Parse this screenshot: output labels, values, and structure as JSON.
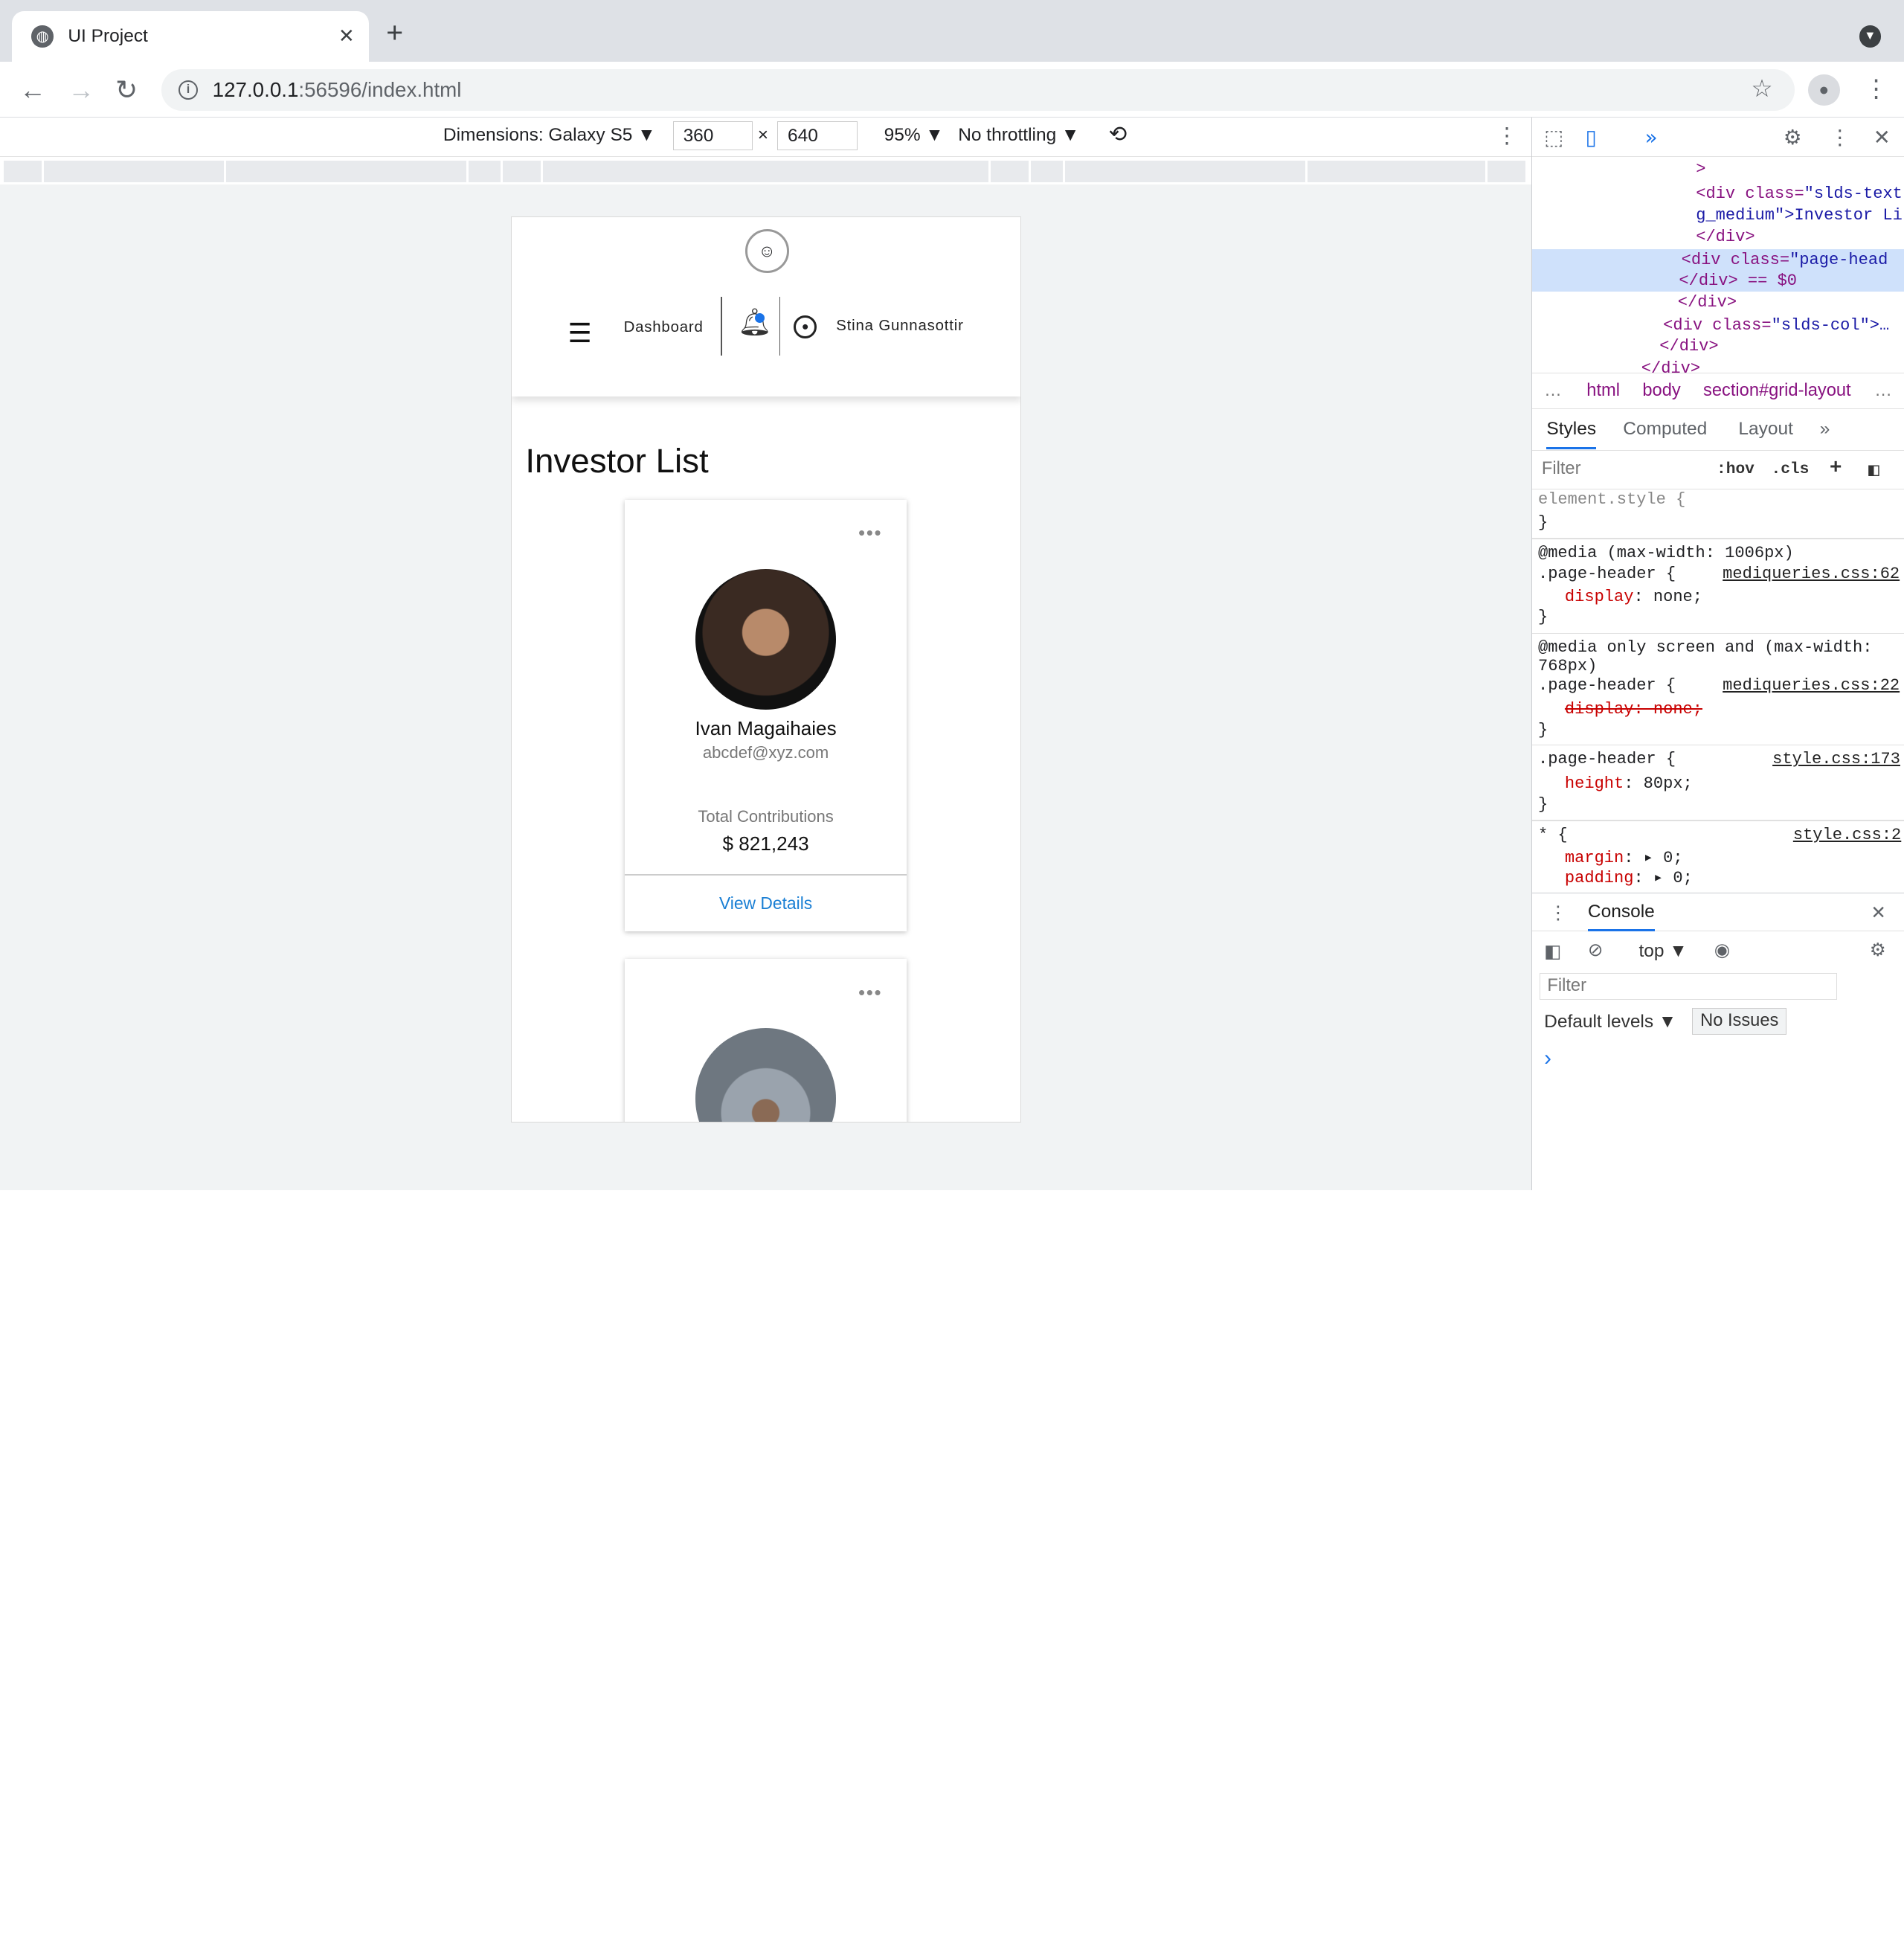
{
  "browser": {
    "tab_title": "UI Project",
    "url_host": "127.0.0.1",
    "url_rest": ":56596/index.html"
  },
  "device_toolbar": {
    "dimensions_label": "Dimensions: Galaxy S5 ▼",
    "width": "360",
    "height": "640",
    "times": "×",
    "zoom": "95% ▼",
    "throttling": "No throttling ▼"
  },
  "app": {
    "nav": {
      "dashboard_label": "Dashboard",
      "user_name": "Stina Gunnasottir"
    },
    "page_title": "Investor List",
    "investors": [
      {
        "name": "Ivan Magaihaies",
        "email": "abcdef@xyz.com",
        "contrib_label": "Total Contributions",
        "contrib_value": "$ 821,243",
        "link_label": "View Details"
      }
    ]
  },
  "devtools": {
    "dom_lines": {
      "l1": ">",
      "l2_tag": "<div class=",
      "l2_val": "\"slds-text",
      "l3": "g_medium\">Investor Li",
      "l4": "</div>",
      "l5_tag": "<div class=",
      "l5_val": "\"page-head",
      "l6": "</div> == $0",
      "l7": "</div>",
      "l8_tag": "<div class=",
      "l8_val": "\"slds-col\">…",
      "l9": "</div>",
      "l10": "</div>"
    },
    "breadcrumbs": {
      "dots": "…",
      "html": "html",
      "body": "body",
      "section": "section#grid-layout",
      "more": "…"
    },
    "tabs": {
      "styles": "Styles",
      "computed": "Computed",
      "layout": "Layout",
      "more": "»"
    },
    "filter_placeholder": "Filter",
    "hov": ":hov",
    "cls": ".cls",
    "rules": {
      "r1": "element.style {",
      "r1c": "}",
      "r2a": "@media (max-width: 1006px)",
      "r2b": ".page-header {",
      "r2src": "mediqueries.css:62",
      "r2p": "display",
      "r2v": ": none;",
      "r2c": "}",
      "r3a": "@media only screen and (max-width:",
      "r3b": "768px)",
      "r3c": ".page-header {",
      "r3src": "mediqueries.css:22",
      "r3p": "display: none;",
      "r3e": "}",
      "r4a": ".page-header {",
      "r4src": "style.css:173",
      "r4p": "height",
      "r4v": ": 80px;",
      "r4c": "}",
      "r5a": "* {",
      "r5src": "style.css:2",
      "r5p1": "margin",
      "r5v1": ": ▸ 0;",
      "r5p2": "padding",
      "r5v2": ": ▸ 0;"
    },
    "console": {
      "label": "Console",
      "top_label": "top ▼",
      "filter": "Filter",
      "levels": "Default levels ▼",
      "issues": "No Issues",
      "prompt": "›"
    }
  }
}
